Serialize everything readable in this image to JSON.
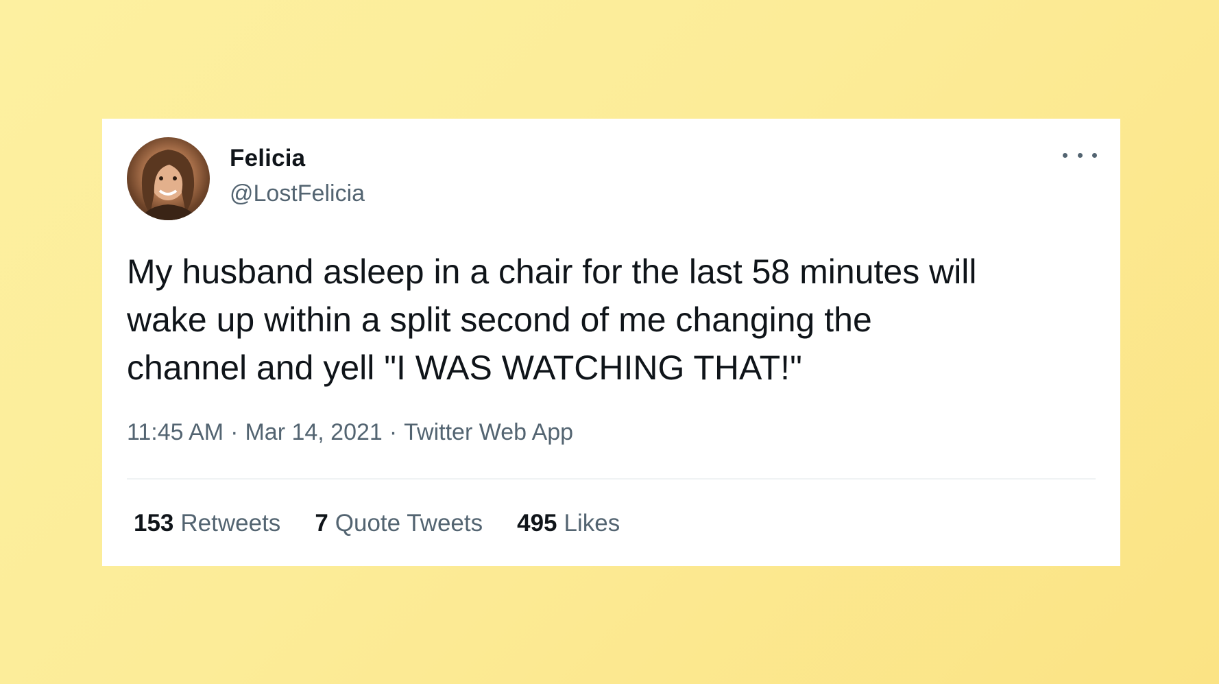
{
  "tweet": {
    "author": {
      "display_name": "Felicia",
      "handle": "@LostFelicia",
      "avatar_icon": "profile-photo"
    },
    "more_icon": "more-options-icon",
    "text": "My husband asleep in a chair for the last 58 minutes will\nwake up within a split second of me changing the\nchannel and yell \"I WAS WATCHING THAT!\"",
    "time": "11:45 AM",
    "date": "Mar 14, 2021",
    "source": "Twitter Web App",
    "separator": "·",
    "stats": [
      {
        "count": "153",
        "label": "Retweets"
      },
      {
        "count": "7",
        "label": "Quote Tweets"
      },
      {
        "count": "495",
        "label": "Likes"
      }
    ]
  },
  "colors": {
    "background": "#fcec98",
    "card": "#ffffff",
    "primary_text": "#0f1419",
    "secondary_text": "#536471"
  }
}
